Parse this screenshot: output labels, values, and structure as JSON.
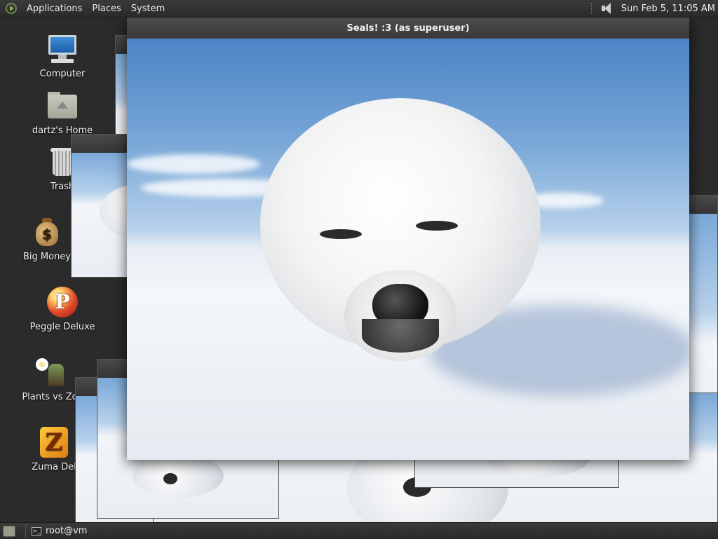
{
  "top_panel": {
    "menus": [
      "Applications",
      "Places",
      "System"
    ],
    "clock": "Sun Feb  5, 11:05 AM",
    "volume_icon": "speaker-icon"
  },
  "desktop_icons": [
    {
      "label": "Computer",
      "icon": "computer-icon"
    },
    {
      "label": "dartz's Home",
      "icon": "home-folder-icon"
    },
    {
      "label": "Trash",
      "icon": "trash-icon"
    },
    {
      "label": "Big Money",
      "icon": "money-bag-icon"
    },
    {
      "label": "Peggle Deluxe",
      "icon": "peggle-icon"
    },
    {
      "label": "Plants vs Zo",
      "icon": "plants-vs-zombies-icon"
    },
    {
      "label": "Zuma Del",
      "icon": "zuma-icon"
    }
  ],
  "main_window": {
    "title": "Seals! :3 (as superuser)",
    "image_subject": "baby harp seal on snow"
  },
  "taskbar": {
    "tasks": [
      {
        "label": "root@vm",
        "icon": "terminal-icon"
      }
    ]
  }
}
